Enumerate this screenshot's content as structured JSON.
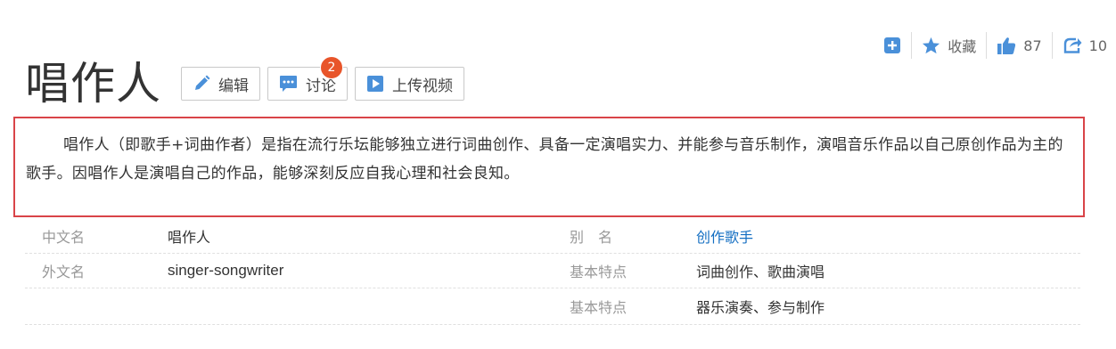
{
  "toolbar": {
    "collect_label": "收藏",
    "like_count": "87",
    "share_count": "10",
    "accent_color": "#4a90d9"
  },
  "title": "唱作人",
  "actions": {
    "edit_label": "编辑",
    "discuss_label": "讨论",
    "discuss_badge": "2",
    "upload_video_label": "上传视频"
  },
  "summary": {
    "text": "唱作人（即歌手+词曲作者）是指在流行乐坛能够独立进行词曲创作、具备一定演唱实力、并能参与音乐制作，演唱音乐作品以自己原创作品为主的歌手。因唱作人是演唱自己的作品，能够深刻反应自我心理和社会良知。",
    "border_color": "#d94448"
  },
  "basic_info": {
    "rows": [
      {
        "name1": "中文名",
        "value1": "唱作人",
        "name2": "别　名",
        "value2": "创作歌手"
      },
      {
        "name1": "外文名",
        "value1": "singer-songwriter",
        "name2": "基本特点",
        "value2": "词曲创作、歌曲演唱"
      },
      {
        "name1": "",
        "value1": "",
        "name2": "基本特点",
        "value2": "器乐演奏、参与制作"
      }
    ]
  }
}
